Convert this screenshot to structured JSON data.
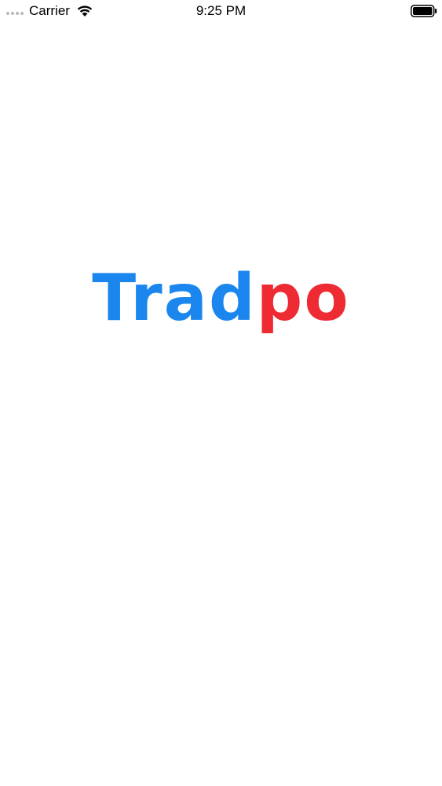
{
  "status_bar": {
    "carrier": "Carrier",
    "time": "9:25 PM",
    "signal_icon": "signal-dots-icon",
    "wifi_icon": "wifi-icon",
    "battery_icon": "battery-icon"
  },
  "logo": {
    "part1": "Trad",
    "part2": "po",
    "part1_color": "#1a86ee",
    "part2_color": "#ee2b33"
  }
}
